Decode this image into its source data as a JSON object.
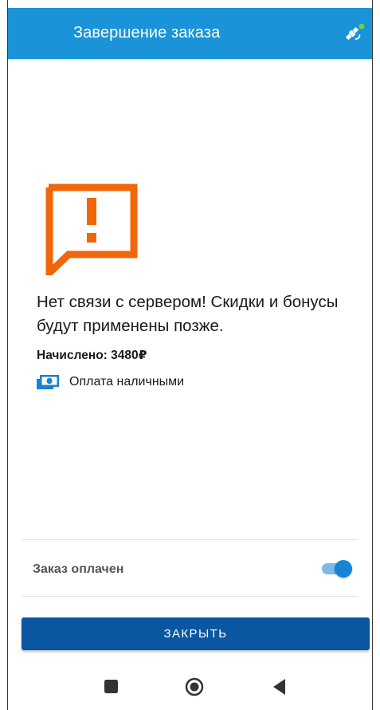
{
  "app_bar": {
    "title": "Завершение заказа",
    "color": "#1a93d8",
    "status_icon": "satellite-icon",
    "status_dot_color": "#6fd13c"
  },
  "message": {
    "icon": "warning-icon",
    "icon_color": "#f0660a",
    "text": "Нет связи с сервером! Скидки и бонусы будут применены позже."
  },
  "order": {
    "accrued": "Начислено: 3480₽",
    "payment_icon": "cash-icon",
    "payment_method": "Оплата наличными"
  },
  "paid_toggle": {
    "label": "Заказ оплачен",
    "checked": true,
    "accent_color": "#1784d9"
  },
  "actions": {
    "close_label": "ЗАКРЫТЬ",
    "close_color": "#0b56a1"
  },
  "nav_bar": {
    "items": [
      "recents-icon",
      "home-icon",
      "back-icon"
    ]
  }
}
